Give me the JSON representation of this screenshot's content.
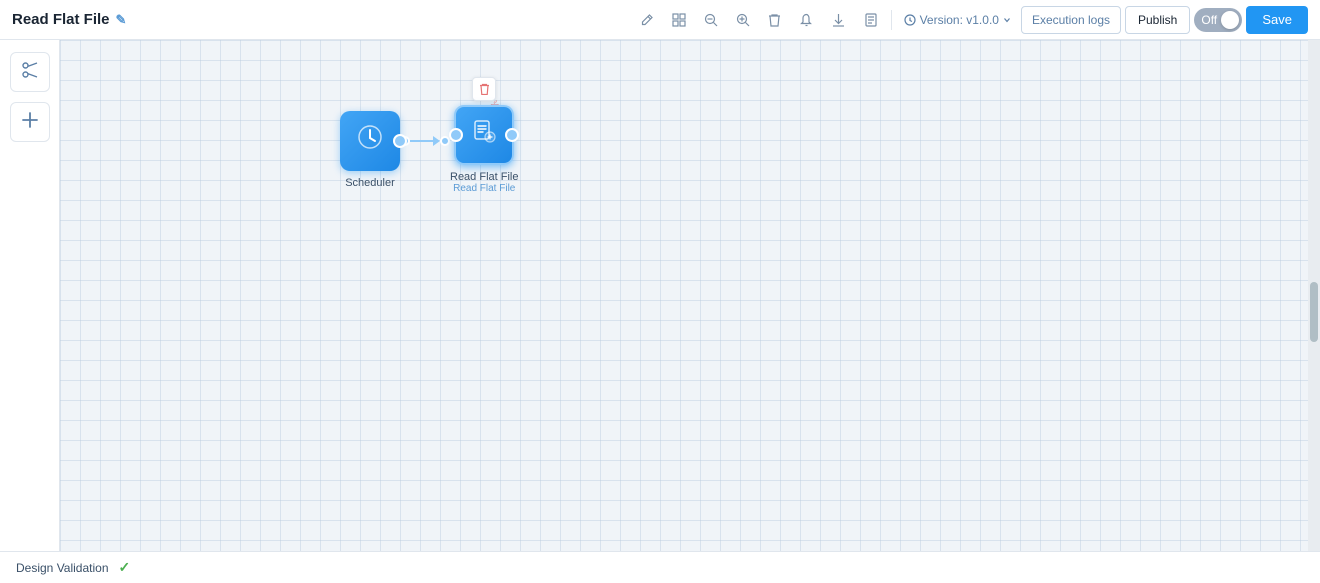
{
  "header": {
    "title": "Read Flat File",
    "edit_icon": "✎",
    "toolbar": {
      "pen_icon": "✏",
      "grid_icon": "⊞",
      "zoom_out_icon": "−",
      "zoom_in_icon": "+",
      "delete_icon": "🗑",
      "bell_icon": "🔔",
      "download_icon": "⬇",
      "doc_icon": "📄"
    },
    "version": {
      "label": "Version: v1.0.0",
      "info_icon": "ℹ"
    },
    "execution_logs_label": "Execution logs",
    "publish_label": "Publish",
    "toggle": {
      "state": "Off"
    },
    "save_label": "Save"
  },
  "sidebar": {
    "scissors_icon": "✂",
    "plus_icon": "+"
  },
  "canvas": {
    "nodes": [
      {
        "id": "scheduler",
        "label": "Scheduler",
        "sublabel": "",
        "icon": "⏰",
        "type": "scheduler"
      },
      {
        "id": "read-flat-file",
        "label": "Read Flat File",
        "sublabel": "Read Flat File",
        "icon": "📋",
        "type": "read-flat"
      }
    ]
  },
  "bottom_bar": {
    "label": "Design Validation",
    "check_icon": "✓"
  }
}
